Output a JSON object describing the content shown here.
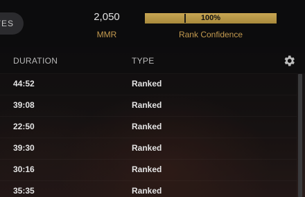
{
  "header": {
    "filter_pill_label": "TES",
    "mmr_value": "2,050",
    "mmr_label": "MMR",
    "rank_confidence_percent_label": "100%",
    "rank_confidence_fraction": 1.0,
    "rank_confidence_label": "Rank Confidence"
  },
  "table": {
    "columns": [
      "DURATION",
      "TYPE"
    ],
    "settings_icon": "gear-icon",
    "rows": [
      {
        "duration": "44:52",
        "type": "Ranked"
      },
      {
        "duration": "39:08",
        "type": "Ranked"
      },
      {
        "duration": "22:50",
        "type": "Ranked"
      },
      {
        "duration": "39:30",
        "type": "Ranked"
      },
      {
        "duration": "30:16",
        "type": "Ranked"
      },
      {
        "duration": "35:35",
        "type": "Ranked"
      }
    ]
  },
  "colors": {
    "accent_gold": "#c39a4f",
    "bar_fill": "#c8a653"
  }
}
